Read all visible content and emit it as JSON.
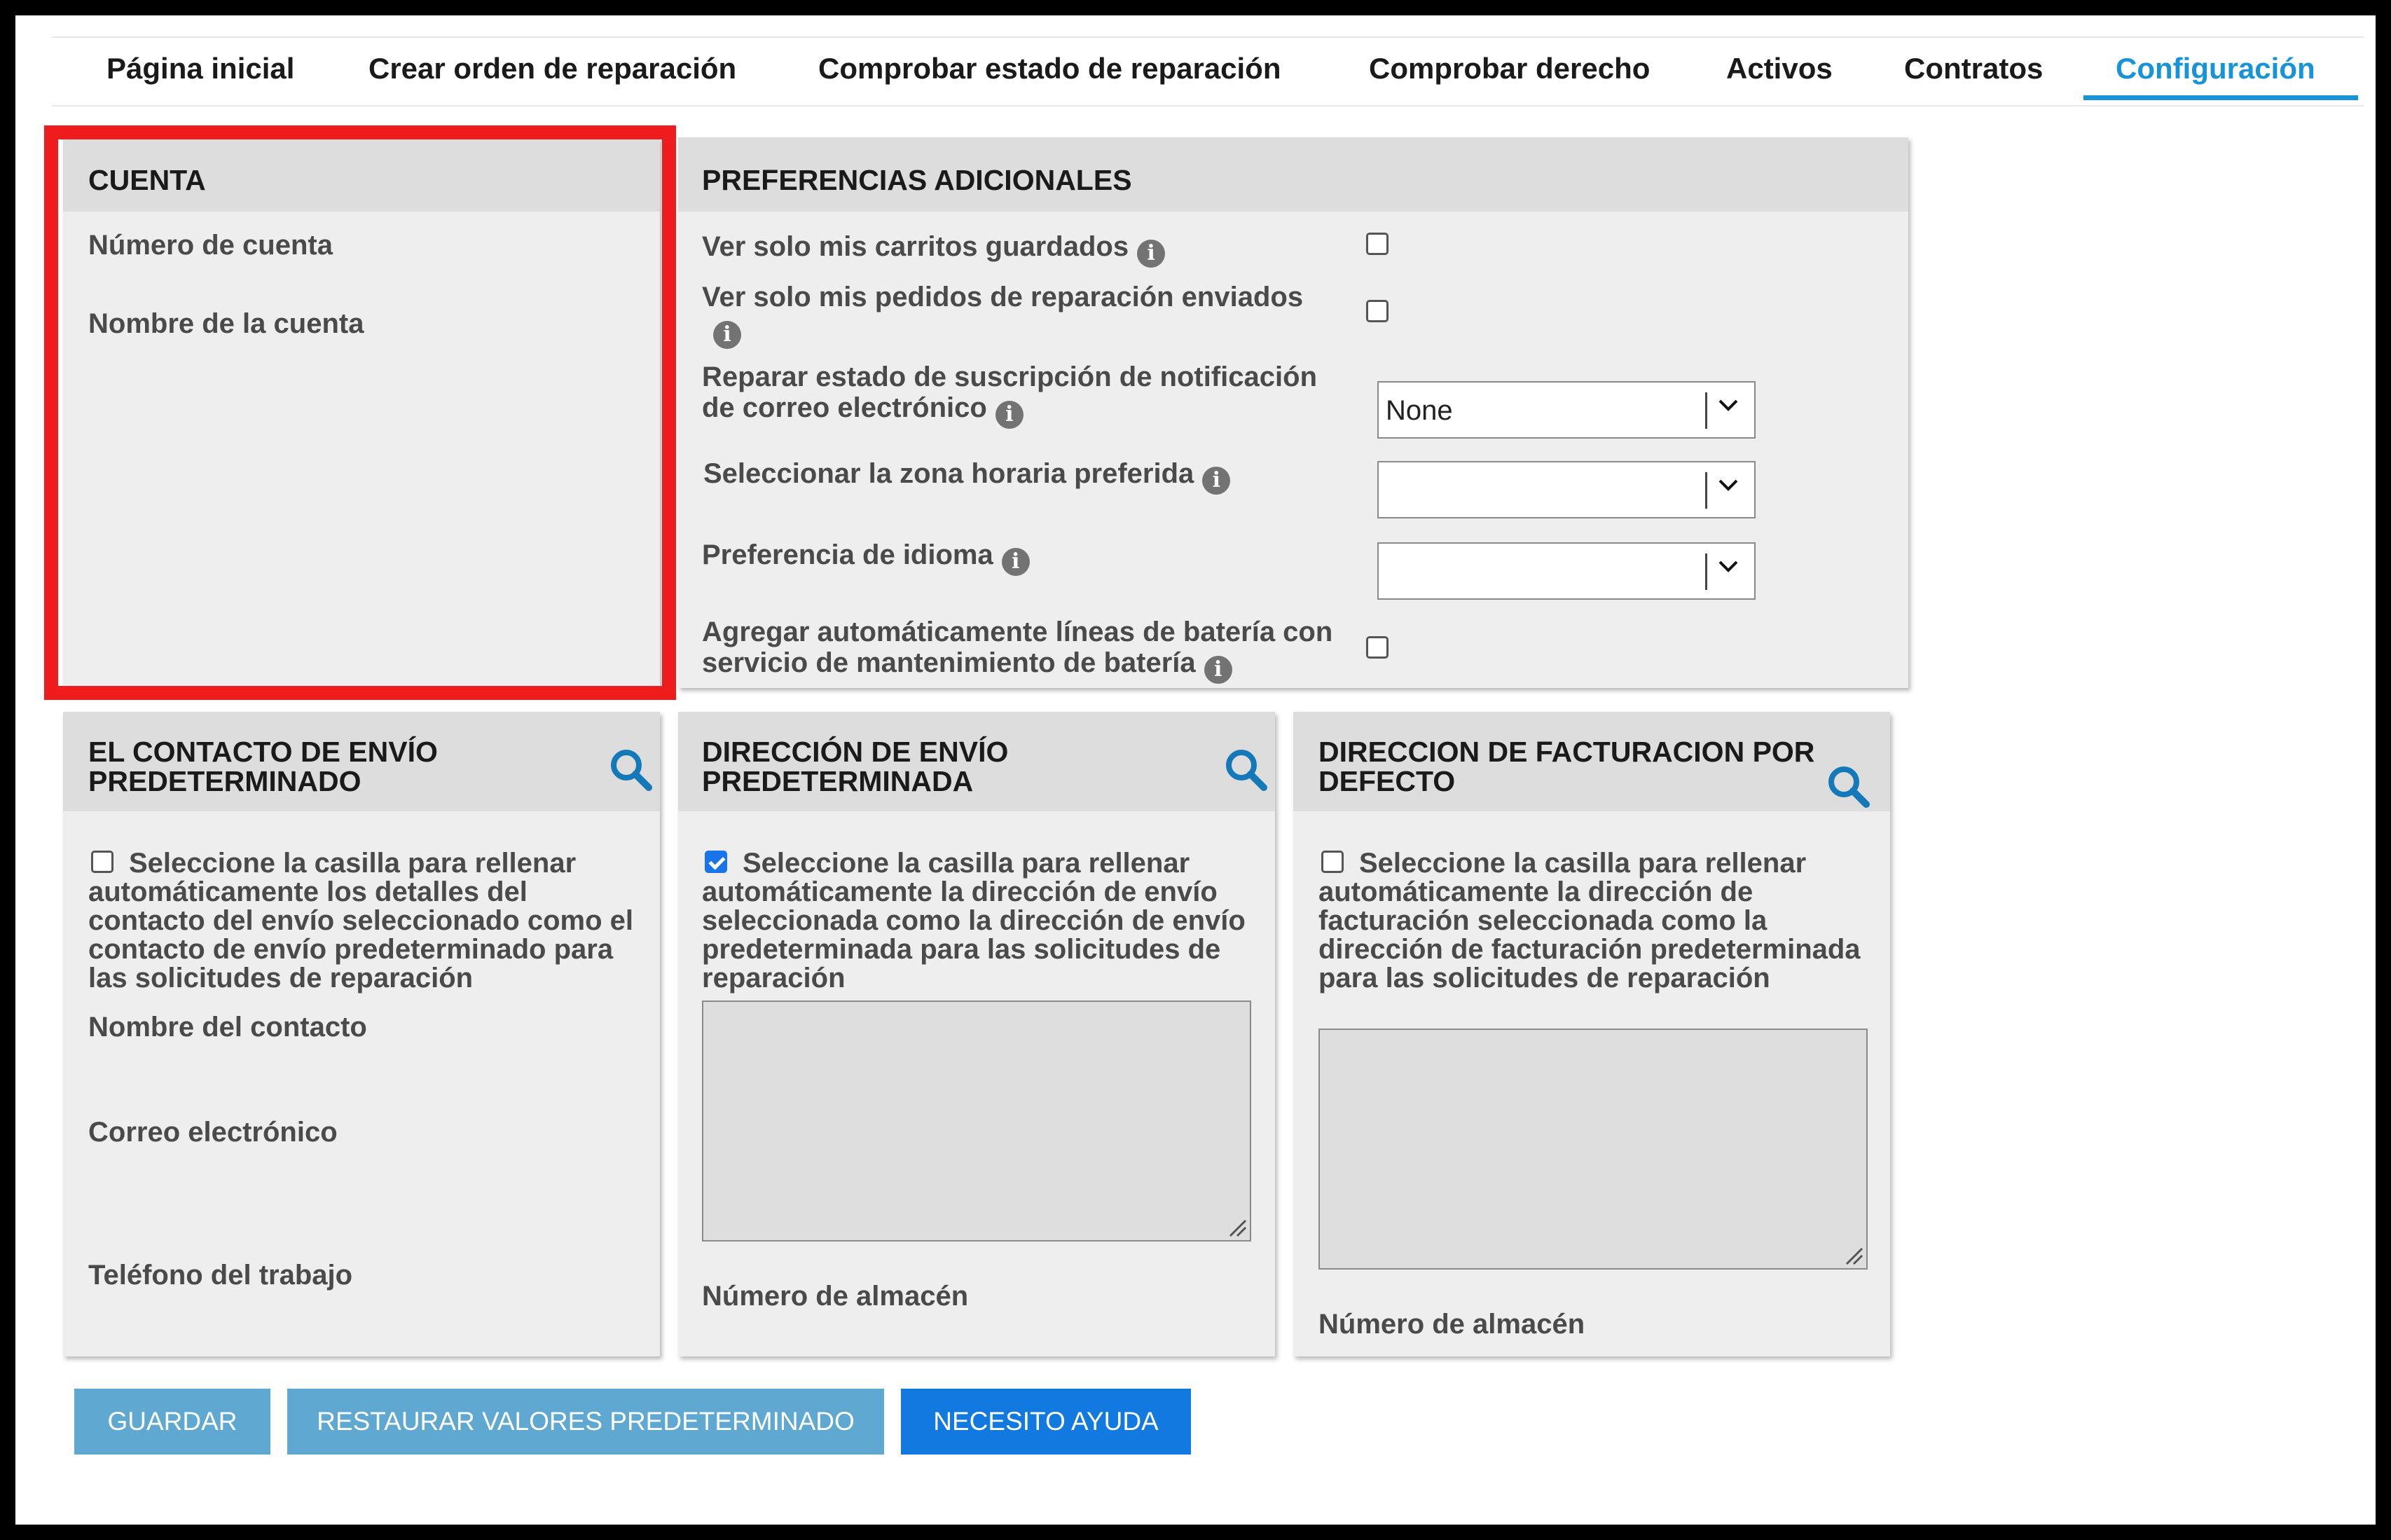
{
  "nav": {
    "tabs": [
      {
        "label": "Página inicial"
      },
      {
        "label": "Crear orden de reparación"
      },
      {
        "label": "Comprobar estado de reparación"
      },
      {
        "label": "Comprobar derecho"
      },
      {
        "label": "Activos"
      },
      {
        "label": "Contratos"
      },
      {
        "label": "Configuración",
        "active": true
      }
    ]
  },
  "cuenta": {
    "title": "CUENTA",
    "account_number_label": "Número de cuenta",
    "account_name_label": "Nombre de la cuenta"
  },
  "preferencias": {
    "title": "PREFERENCIAS ADICIONALES",
    "saved_carts_label": "Ver solo mis carritos guardados",
    "repair_orders_label": "Ver solo mis pedidos de reparación enviados",
    "notification_label": "Reparar estado de suscripción de notificación de correo electrónico",
    "notification_value": "None",
    "timezone_label": "Seleccionar la zona horaria preferida",
    "timezone_value": "",
    "language_label": "Preferencia de idioma",
    "language_value": "",
    "battery_label": "Agregar automáticamente líneas de batería con servicio de mantenimiento de batería",
    "info_glyph": "i"
  },
  "contacto": {
    "title": "EL CONTACTO DE ENVÍO PREDETERMINADO",
    "checkbox_label": "Seleccione la casilla para rellenar automáticamente los detalles del contacto del envío seleccionado como el contacto de envío predeterminado para las solicitudes de reparación",
    "checked": false,
    "contact_name_label": "Nombre del contacto",
    "email_label": "Correo electrónico",
    "work_phone_label": "Teléfono del trabajo"
  },
  "envio": {
    "title": "DIRECCIÓN DE ENVÍO PREDETERMINADA",
    "checkbox_label": "Seleccione la casilla para rellenar automáticamente la dirección de envío seleccionada como la dirección de envío predeterminada para las solicitudes de reparación",
    "checked": true,
    "warehouse_label": "Número de almacén"
  },
  "facturacion": {
    "title": "DIRECCION DE FACTURACION POR DEFECTO",
    "checkbox_label": "Seleccione la casilla para rellenar automáticamente la dirección de facturación seleccionada como la dirección de facturación predeterminada para las solicitudes de reparación",
    "checked": false,
    "warehouse_label": "Número de almacén"
  },
  "buttons": {
    "save": "GUARDAR",
    "restore": "RESTAURAR VALORES PREDETERMINADO",
    "help": "NECESITO AYUDA"
  },
  "colors": {
    "accent": "#1793d8",
    "button_muted": "#5ea8d2",
    "button_primary": "#1279e0",
    "highlight": "#ee1c1c",
    "search_icon": "#1479b8"
  },
  "icons": [
    "info-icon",
    "search-icon",
    "chevron-down-icon",
    "checkbox-icon",
    "resize-grip-icon"
  ]
}
